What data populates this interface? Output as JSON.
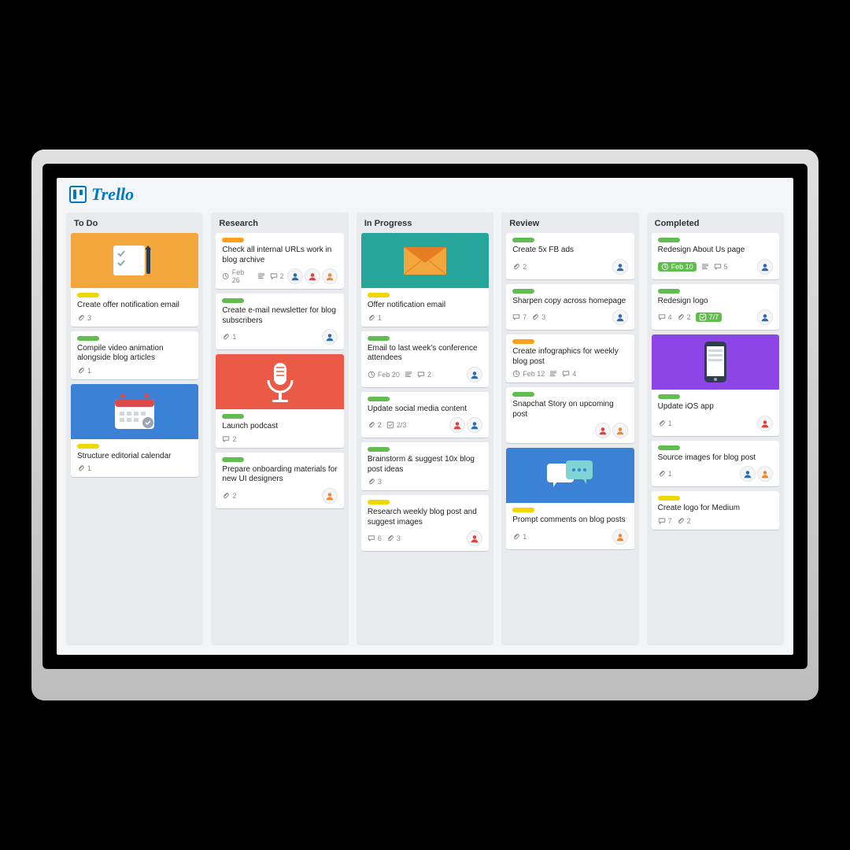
{
  "app": {
    "name": "Trello"
  },
  "labelColors": {
    "green": "c-green",
    "yellow": "c-yellow",
    "orange": "c-orange",
    "blue": "c-blue"
  },
  "avatarPalette": [
    "#2b6cb0",
    "#e53e3e",
    "#ed8936",
    "#2f855a",
    "#6b46c1"
  ],
  "lists": [
    {
      "title": "To Do",
      "cards": [
        {
          "cover": {
            "type": "checklist",
            "bg": "cv-orange"
          },
          "labels": [
            "yellow"
          ],
          "title": "Create offer notification email",
          "attachments": 3,
          "members": []
        },
        {
          "labels": [
            "green"
          ],
          "title": "Compile video animation alongside blog articles",
          "attachments": 1,
          "members": []
        },
        {
          "cover": {
            "type": "calendar",
            "bg": "cv-blue"
          },
          "labels": [
            "yellow"
          ],
          "title": "Structure editorial calendar",
          "attachments": 1,
          "members": []
        }
      ]
    },
    {
      "title": "Research",
      "cards": [
        {
          "labels": [
            "orange"
          ],
          "title": "Check all internal URLs work in blog archive",
          "due": "Feb 26",
          "desc": true,
          "comments": 2,
          "members": [
            0,
            1,
            2
          ]
        },
        {
          "labels": [
            "green"
          ],
          "title": "Create e-mail newsletter for blog subscribers",
          "attachments": 1,
          "members": [
            0
          ]
        },
        {
          "cover": {
            "type": "mic",
            "bg": "cv-red"
          },
          "labels": [
            "green"
          ],
          "title": "Launch podcast",
          "comments": 2,
          "members": []
        },
        {
          "labels": [
            "green"
          ],
          "title": "Prepare onboarding materials for new UI designers",
          "attachments": 2,
          "members": [
            2
          ]
        }
      ]
    },
    {
      "title": "In Progress",
      "cards": [
        {
          "cover": {
            "type": "mail",
            "bg": "cv-teal"
          },
          "labels": [
            "yellow"
          ],
          "title": "Offer notification email",
          "attachments": 1,
          "members": []
        },
        {
          "labels": [
            "green"
          ],
          "title": "Email to last week's conference attendees",
          "due": "Feb 20",
          "desc": true,
          "comments": 2,
          "members": [
            0
          ]
        },
        {
          "labels": [
            "green"
          ],
          "title": "Update social media content",
          "attachments": 2,
          "checklist": "2/3",
          "members": [
            1,
            0
          ]
        },
        {
          "labels": [
            "green"
          ],
          "title": "Brainstorm & suggest 10x blog post ideas",
          "attachments": 3,
          "members": []
        },
        {
          "labels": [
            "yellow"
          ],
          "title": "Research weekly blog post and suggest images",
          "attachments": 3,
          "comments": 6,
          "members": [
            1
          ]
        }
      ]
    },
    {
      "title": "Review",
      "cards": [
        {
          "labels": [
            "green"
          ],
          "title": "Create 5x FB ads",
          "attachments": 2,
          "members": [
            0
          ]
        },
        {
          "labels": [
            "green"
          ],
          "title": "Sharpen copy across homepage",
          "comments": 7,
          "attachments": 3,
          "members": [
            0
          ]
        },
        {
          "labels": [
            "orange"
          ],
          "title": "Create infographics for weekly blog post",
          "due": "Feb 12",
          "desc": true,
          "comments": 4,
          "members": []
        },
        {
          "labels": [
            "green"
          ],
          "title": "Snapchat Story on upcoming post",
          "members": [
            1,
            2
          ]
        },
        {
          "cover": {
            "type": "chat",
            "bg": "cv-blue"
          },
          "labels": [
            "yellow"
          ],
          "title": "Prompt comments on blog posts",
          "attachments": 1,
          "members": [
            2
          ]
        }
      ]
    },
    {
      "title": "Completed",
      "cards": [
        {
          "labels": [
            "green"
          ],
          "title": "Redesign About Us page",
          "dueDone": "Feb 10",
          "desc": true,
          "comments": 5,
          "members": [
            0
          ]
        },
        {
          "labels": [
            "green"
          ],
          "title": "Redesign logo",
          "comments": 4,
          "attachments": 2,
          "checklistDone": "7/7",
          "members": [
            0
          ]
        },
        {
          "cover": {
            "type": "phone",
            "bg": "cv-purple"
          },
          "labels": [
            "green"
          ],
          "title": "Update iOS app",
          "attachments": 1,
          "members": [
            1
          ]
        },
        {
          "labels": [
            "green"
          ],
          "title": "Source images for blog post",
          "attachments": 1,
          "members": [
            0,
            2
          ]
        },
        {
          "labels": [
            "yellow"
          ],
          "title": "Create logo for Medium",
          "comments": 7,
          "attachments": 2,
          "members": []
        }
      ]
    }
  ]
}
